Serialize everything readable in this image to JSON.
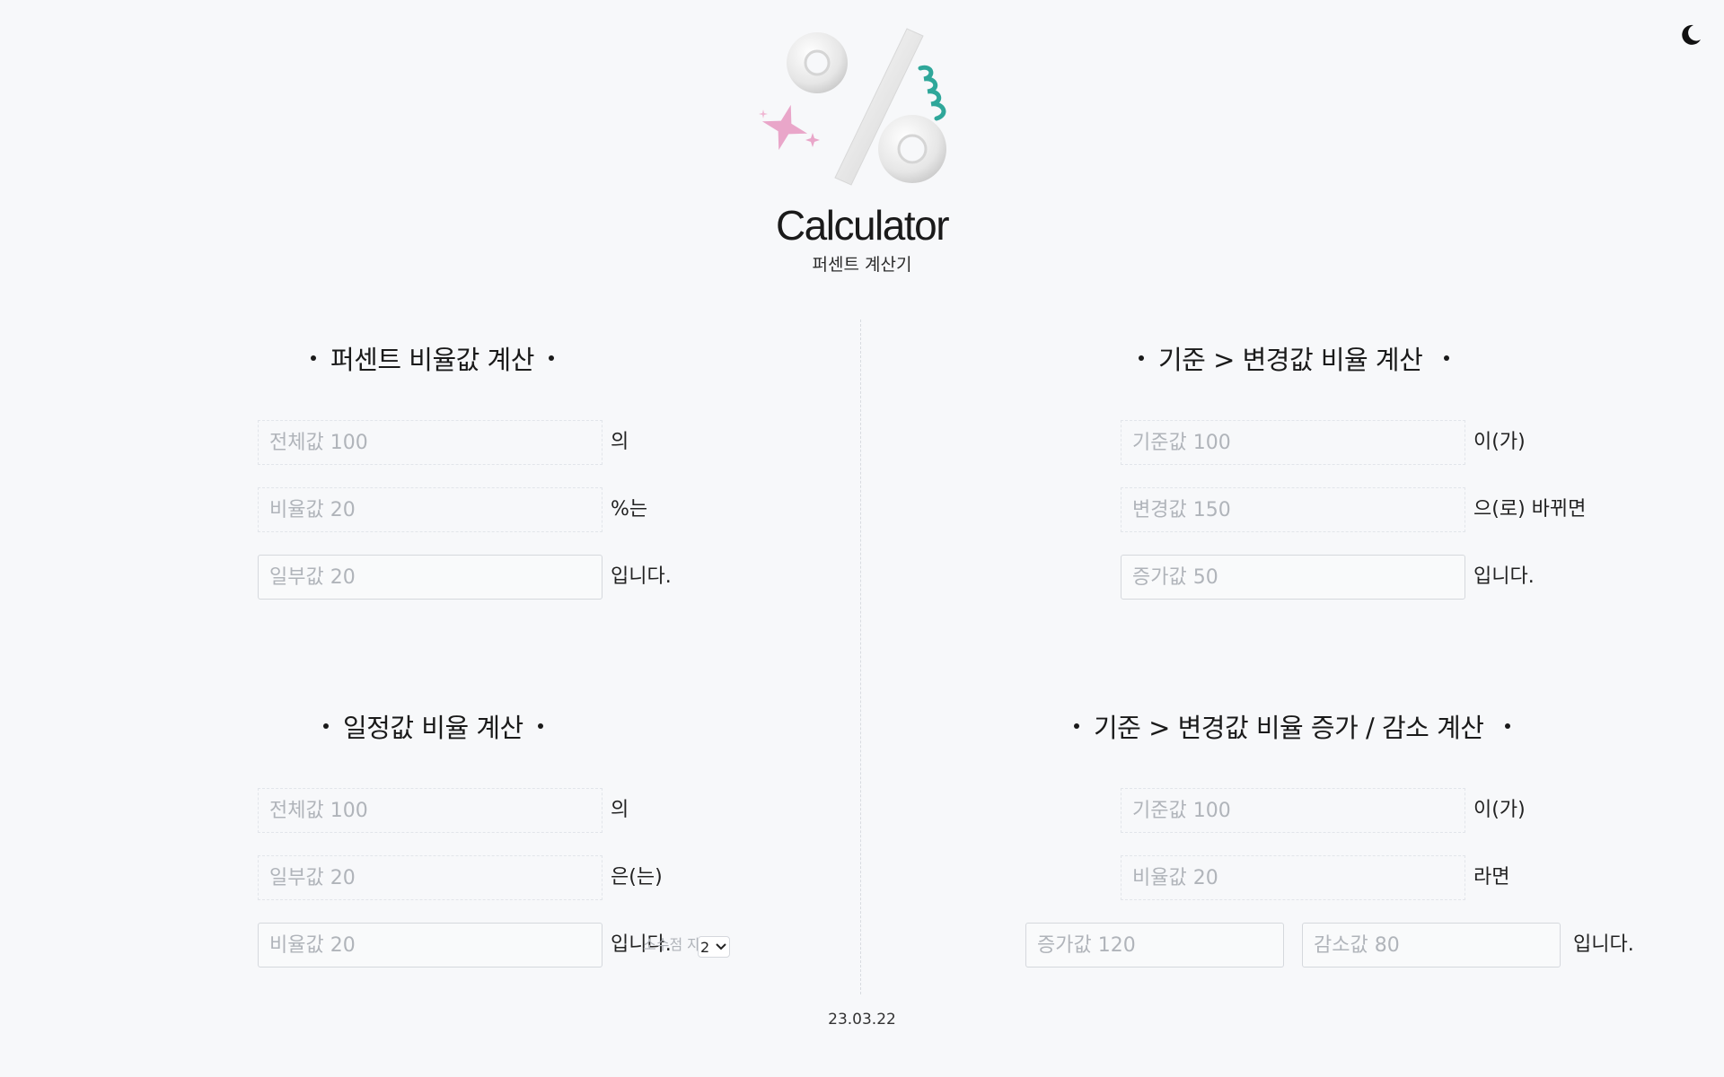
{
  "theme_toggle": {
    "icon": "moon-icon"
  },
  "header": {
    "title": "Calculator",
    "subtitle": "퍼센트 계산기",
    "logo_icon": "percent-logo-icon"
  },
  "sections": {
    "percent_ratio": {
      "title": "퍼센트 비율값 계산",
      "total_placeholder": "전체값 100",
      "total_suffix": "의",
      "ratio_placeholder": "비율값 20",
      "ratio_suffix": "%는",
      "part_placeholder": "일부값 20",
      "part_suffix": "입니다."
    },
    "change_ratio": {
      "title": "기준 > 변경값 비율 계산",
      "base_placeholder": "기준값 100",
      "base_suffix": "이(가)",
      "changed_placeholder": "변경값 150",
      "changed_suffix": "으(로) 바뀌면",
      "increase_placeholder": "증가값 50",
      "increase_suffix": "입니다."
    },
    "part_ratio": {
      "title": "일정값 비율 계산",
      "total_placeholder": "전체값 100",
      "total_suffix": "의",
      "part_placeholder": "일부값 20",
      "part_suffix": "은(는)",
      "ratio_placeholder": "비율값 20",
      "ratio_suffix": "입니다.",
      "decimal_label": "소수점 자리",
      "decimal_value": "2"
    },
    "increase_decrease": {
      "title": "기준 > 변경값 비율 증가 / 감소 계산",
      "base_placeholder": "기준값 100",
      "base_suffix": "이(가)",
      "ratio_placeholder": "비율값 20",
      "ratio_suffix": "라면",
      "increase_placeholder": "증가값 120",
      "decrease_placeholder": "감소값 80",
      "result_suffix": "입니다."
    }
  },
  "footer": {
    "date": "23.03.22"
  }
}
